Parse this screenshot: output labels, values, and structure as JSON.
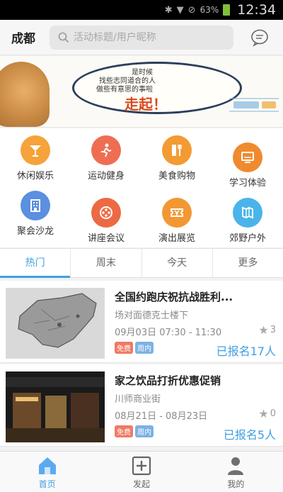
{
  "status_bar": {
    "battery_pct": "63%",
    "time": "12:34"
  },
  "header": {
    "city": "成都",
    "search_placeholder": "活动标题/用户昵称"
  },
  "banner": {
    "line1": "是时候",
    "line2": "找些志同道合的人",
    "line3": "做些有意思的事啦",
    "slogan": "走起！"
  },
  "categories": [
    {
      "label": "休闲娱乐",
      "icon": "cocktail-icon",
      "color": "#f5a33a"
    },
    {
      "label": "运动健身",
      "icon": "runner-icon",
      "color": "#ee6e52"
    },
    {
      "label": "美食购物",
      "icon": "dining-icon",
      "color": "#f39a33"
    },
    {
      "label": "学习体验",
      "icon": "monitor-icon",
      "color": "#f08a2e"
    },
    {
      "label": "聚会沙龙",
      "icon": "building-icon",
      "color": "#5b8fe0"
    },
    {
      "label": "讲座会议",
      "icon": "film-reel-icon",
      "color": "#ec6a43"
    },
    {
      "label": "演出展览",
      "icon": "ticket-icon",
      "color": "#f29734"
    },
    {
      "label": "郊野户外",
      "icon": "map-icon",
      "color": "#4ab4ea"
    }
  ],
  "tabs": [
    {
      "label": "热门",
      "active": true
    },
    {
      "label": "周末",
      "active": false
    },
    {
      "label": "今天",
      "active": false
    },
    {
      "label": "更多",
      "active": false
    }
  ],
  "events": [
    {
      "title": "全国约跑庆祝抗战胜利...",
      "location": "场对面德克士楼下",
      "time": "09月03日 07:30 - 11:30",
      "stars": "3",
      "tag_free": "免费",
      "tag_week": "周内",
      "signed": "已报名17人"
    },
    {
      "title": "家之饮品打折优惠促销",
      "location": "川师商业街",
      "time": "08月21日 - 08月23日",
      "stars": "0",
      "tag_free": "免费",
      "tag_week": "周内",
      "signed": "已报名5人"
    }
  ],
  "bottom_nav": [
    {
      "label": "首页",
      "icon": "home-icon",
      "active": true
    },
    {
      "label": "发起",
      "icon": "add-box-icon",
      "active": false
    },
    {
      "label": "我的",
      "icon": "user-icon",
      "active": false
    }
  ]
}
